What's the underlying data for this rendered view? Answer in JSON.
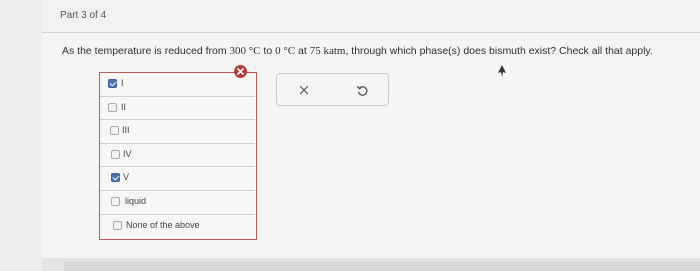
{
  "part": {
    "label": "Part 3 of 4"
  },
  "question": {
    "before": "As the temperature is reduced from ",
    "t1": "300 °C",
    "mid1": " to ",
    "t2": "0 °C",
    "mid2": " at ",
    "p": "75 katm",
    "after": ", through which phase(s) does bismuth exist? Check all that apply."
  },
  "options": [
    {
      "label": "I",
      "checked": true
    },
    {
      "label": "II",
      "checked": false
    },
    {
      "label": "III",
      "checked": false
    },
    {
      "label": "IV",
      "checked": false
    },
    {
      "label": "V",
      "checked": true
    },
    {
      "label": "liquid",
      "checked": false
    },
    {
      "label": "None of the above",
      "checked": false
    }
  ],
  "colors": {
    "error": "#b23b3b",
    "checkbox_checked": "#4a6fb0"
  },
  "icons": {
    "error": "x-circle-icon",
    "clear": "close-icon",
    "retry": "undo-icon"
  }
}
